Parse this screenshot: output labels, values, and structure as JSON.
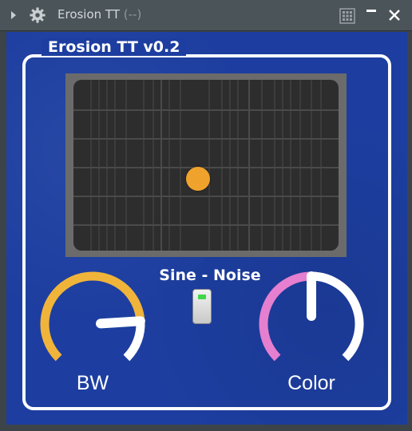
{
  "window": {
    "title": "Erosion TT",
    "subtitle": "(--)"
  },
  "plugin": {
    "title": "Erosion TT v0.2"
  },
  "xy_pad": {
    "handle_x": 0.47,
    "handle_y": 0.58,
    "handle_color": "#f0a32c",
    "grid_color": "#4a4a4a",
    "background_color": "#2d2d2d"
  },
  "switch": {
    "label": "Sine - Noise",
    "led_color": "#41d64a"
  },
  "knobs": [
    {
      "id": "bw",
      "label": "BW",
      "value": 0.82,
      "arc_color": "#f0b43a"
    },
    {
      "id": "color",
      "label": "Color",
      "value": 0.5,
      "arc_color": "#e67fcf"
    }
  ],
  "colors": {
    "panel": "#1d3ea0",
    "frame": "#ffffff",
    "titlebar": "#4b5459"
  },
  "icons": {
    "expand": "triangle-right-icon",
    "settings": "gear-icon",
    "layout": "grid-icon",
    "minimize": "minimize-icon",
    "close": "close-icon"
  }
}
